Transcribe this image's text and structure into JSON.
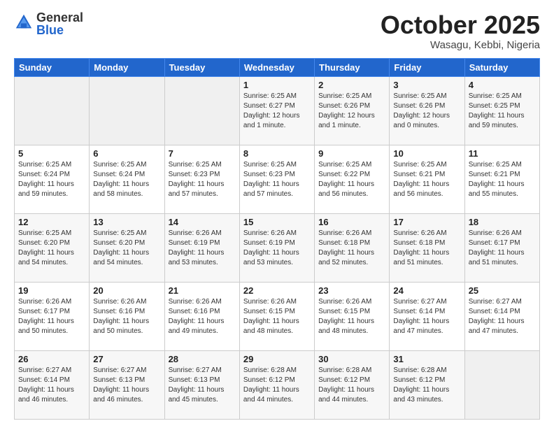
{
  "logo": {
    "general": "General",
    "blue": "Blue"
  },
  "header": {
    "month": "October 2025",
    "location": "Wasagu, Kebbi, Nigeria"
  },
  "weekdays": [
    "Sunday",
    "Monday",
    "Tuesday",
    "Wednesday",
    "Thursday",
    "Friday",
    "Saturday"
  ],
  "weeks": [
    [
      {
        "day": "",
        "info": ""
      },
      {
        "day": "",
        "info": ""
      },
      {
        "day": "",
        "info": ""
      },
      {
        "day": "1",
        "info": "Sunrise: 6:25 AM\nSunset: 6:27 PM\nDaylight: 12 hours\nand 1 minute."
      },
      {
        "day": "2",
        "info": "Sunrise: 6:25 AM\nSunset: 6:26 PM\nDaylight: 12 hours\nand 1 minute."
      },
      {
        "day": "3",
        "info": "Sunrise: 6:25 AM\nSunset: 6:26 PM\nDaylight: 12 hours\nand 0 minutes."
      },
      {
        "day": "4",
        "info": "Sunrise: 6:25 AM\nSunset: 6:25 PM\nDaylight: 11 hours\nand 59 minutes."
      }
    ],
    [
      {
        "day": "5",
        "info": "Sunrise: 6:25 AM\nSunset: 6:24 PM\nDaylight: 11 hours\nand 59 minutes."
      },
      {
        "day": "6",
        "info": "Sunrise: 6:25 AM\nSunset: 6:24 PM\nDaylight: 11 hours\nand 58 minutes."
      },
      {
        "day": "7",
        "info": "Sunrise: 6:25 AM\nSunset: 6:23 PM\nDaylight: 11 hours\nand 57 minutes."
      },
      {
        "day": "8",
        "info": "Sunrise: 6:25 AM\nSunset: 6:23 PM\nDaylight: 11 hours\nand 57 minutes."
      },
      {
        "day": "9",
        "info": "Sunrise: 6:25 AM\nSunset: 6:22 PM\nDaylight: 11 hours\nand 56 minutes."
      },
      {
        "day": "10",
        "info": "Sunrise: 6:25 AM\nSunset: 6:21 PM\nDaylight: 11 hours\nand 56 minutes."
      },
      {
        "day": "11",
        "info": "Sunrise: 6:25 AM\nSunset: 6:21 PM\nDaylight: 11 hours\nand 55 minutes."
      }
    ],
    [
      {
        "day": "12",
        "info": "Sunrise: 6:25 AM\nSunset: 6:20 PM\nDaylight: 11 hours\nand 54 minutes."
      },
      {
        "day": "13",
        "info": "Sunrise: 6:25 AM\nSunset: 6:20 PM\nDaylight: 11 hours\nand 54 minutes."
      },
      {
        "day": "14",
        "info": "Sunrise: 6:26 AM\nSunset: 6:19 PM\nDaylight: 11 hours\nand 53 minutes."
      },
      {
        "day": "15",
        "info": "Sunrise: 6:26 AM\nSunset: 6:19 PM\nDaylight: 11 hours\nand 53 minutes."
      },
      {
        "day": "16",
        "info": "Sunrise: 6:26 AM\nSunset: 6:18 PM\nDaylight: 11 hours\nand 52 minutes."
      },
      {
        "day": "17",
        "info": "Sunrise: 6:26 AM\nSunset: 6:18 PM\nDaylight: 11 hours\nand 51 minutes."
      },
      {
        "day": "18",
        "info": "Sunrise: 6:26 AM\nSunset: 6:17 PM\nDaylight: 11 hours\nand 51 minutes."
      }
    ],
    [
      {
        "day": "19",
        "info": "Sunrise: 6:26 AM\nSunset: 6:17 PM\nDaylight: 11 hours\nand 50 minutes."
      },
      {
        "day": "20",
        "info": "Sunrise: 6:26 AM\nSunset: 6:16 PM\nDaylight: 11 hours\nand 50 minutes."
      },
      {
        "day": "21",
        "info": "Sunrise: 6:26 AM\nSunset: 6:16 PM\nDaylight: 11 hours\nand 49 minutes."
      },
      {
        "day": "22",
        "info": "Sunrise: 6:26 AM\nSunset: 6:15 PM\nDaylight: 11 hours\nand 48 minutes."
      },
      {
        "day": "23",
        "info": "Sunrise: 6:26 AM\nSunset: 6:15 PM\nDaylight: 11 hours\nand 48 minutes."
      },
      {
        "day": "24",
        "info": "Sunrise: 6:27 AM\nSunset: 6:14 PM\nDaylight: 11 hours\nand 47 minutes."
      },
      {
        "day": "25",
        "info": "Sunrise: 6:27 AM\nSunset: 6:14 PM\nDaylight: 11 hours\nand 47 minutes."
      }
    ],
    [
      {
        "day": "26",
        "info": "Sunrise: 6:27 AM\nSunset: 6:14 PM\nDaylight: 11 hours\nand 46 minutes."
      },
      {
        "day": "27",
        "info": "Sunrise: 6:27 AM\nSunset: 6:13 PM\nDaylight: 11 hours\nand 46 minutes."
      },
      {
        "day": "28",
        "info": "Sunrise: 6:27 AM\nSunset: 6:13 PM\nDaylight: 11 hours\nand 45 minutes."
      },
      {
        "day": "29",
        "info": "Sunrise: 6:28 AM\nSunset: 6:12 PM\nDaylight: 11 hours\nand 44 minutes."
      },
      {
        "day": "30",
        "info": "Sunrise: 6:28 AM\nSunset: 6:12 PM\nDaylight: 11 hours\nand 44 minutes."
      },
      {
        "day": "31",
        "info": "Sunrise: 6:28 AM\nSunset: 6:12 PM\nDaylight: 11 hours\nand 43 minutes."
      },
      {
        "day": "",
        "info": ""
      }
    ]
  ]
}
